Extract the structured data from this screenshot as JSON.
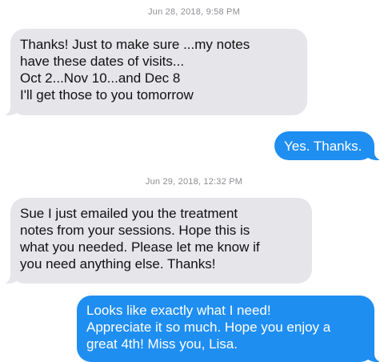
{
  "conversation": {
    "groups": [
      {
        "timestamp": "Jun 28, 2018, 9:58 PM",
        "messages": [
          {
            "direction": "incoming",
            "lines": [
              "Thanks!  Just to make sure ...my notes",
              "have these dates of visits...",
              "Oct 2...Nov 10...and Dec 8",
              "I'll get those to you tomorrow"
            ]
          },
          {
            "direction": "outgoing",
            "lines": [
              "Yes. Thanks."
            ]
          }
        ]
      },
      {
        "timestamp": "Jun 29, 2018, 12:32 PM",
        "messages": [
          {
            "direction": "incoming",
            "lines": [
              "Sue I just emailed you the treatment",
              "notes from your sessions. Hope this is",
              "what you needed. Please let me know if",
              "you need anything else. Thanks!"
            ]
          },
          {
            "direction": "outgoing",
            "lines": [
              "Looks like exactly what I need!",
              "Appreciate it so much. Hope you enjoy a",
              "great 4th! Miss you, Lisa."
            ]
          }
        ]
      }
    ]
  },
  "colors": {
    "incoming_bubble": "#e5e5ea",
    "outgoing_bubble": "#1f8ef1",
    "timestamp_text": "#8e8e93"
  }
}
